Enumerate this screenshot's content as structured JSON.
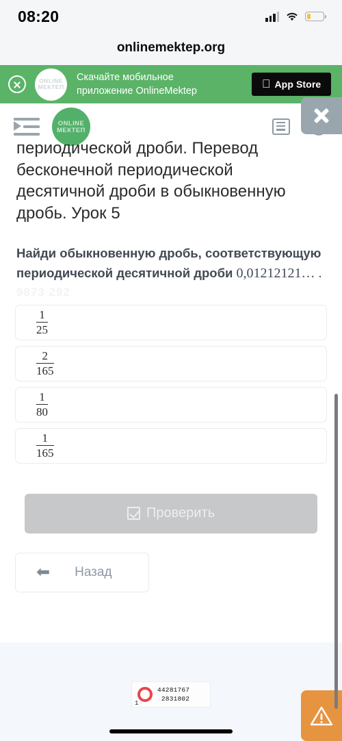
{
  "statusbar": {
    "time": "08:20",
    "signal_icon": "signal-bars-icon",
    "wifi_icon": "wifi-icon",
    "battery_icon": "battery-low-icon"
  },
  "browser": {
    "url": "onlinemektep.org"
  },
  "app_banner": {
    "close_icon": "close-circle-icon",
    "logo_line1": "ONLINE",
    "logo_line2": "МЕКТЕП",
    "text_line1": "Скачайте мобильное",
    "text_line2": "приложение OnlineMektep",
    "store_button": "App Store",
    "apple_icon": "apple-icon",
    "background_color": "#5bb368"
  },
  "ad_overlay": {
    "close_icon": "close-x-icon",
    "background_color": "#9aa6ad"
  },
  "navbar": {
    "menu_icon": "menu-indent-icon",
    "logo_line1": "ONLINE",
    "logo_line2": "МЕКТЕП",
    "list_icon": "list-icon",
    "globe_icon": "globe-icon",
    "logo_color": "#52b06a"
  },
  "lesson": {
    "title": "периодической дроби. Перевод бесконечной периодической десятичной дроби в обыкновенную дробь. Урок 5"
  },
  "question": {
    "prompt_bold": "Найди обыкновенную дробь, соответствующую периодической десятичной дроби ",
    "value": "0,01212121… .",
    "ghost_text": "9873 292"
  },
  "options": [
    {
      "numerator": "1",
      "denominator": "25"
    },
    {
      "numerator": "2",
      "denominator": "165"
    },
    {
      "numerator": "1",
      "denominator": "80"
    },
    {
      "numerator": "1",
      "denominator": "165"
    }
  ],
  "actions": {
    "check_label": "Проверить",
    "check_icon": "checkbox-checked-icon",
    "check_disabled_color": "#c6c8ca",
    "back_label": "Назад",
    "back_icon": "arrow-left-icon"
  },
  "footer": {
    "counter_icon": "red-ring-icon",
    "counter_top": "44281767",
    "counter_bottom": "2831802",
    "counter_index": "1",
    "warning_icon": "warning-triangle-icon",
    "warning_color": "#e79440"
  }
}
